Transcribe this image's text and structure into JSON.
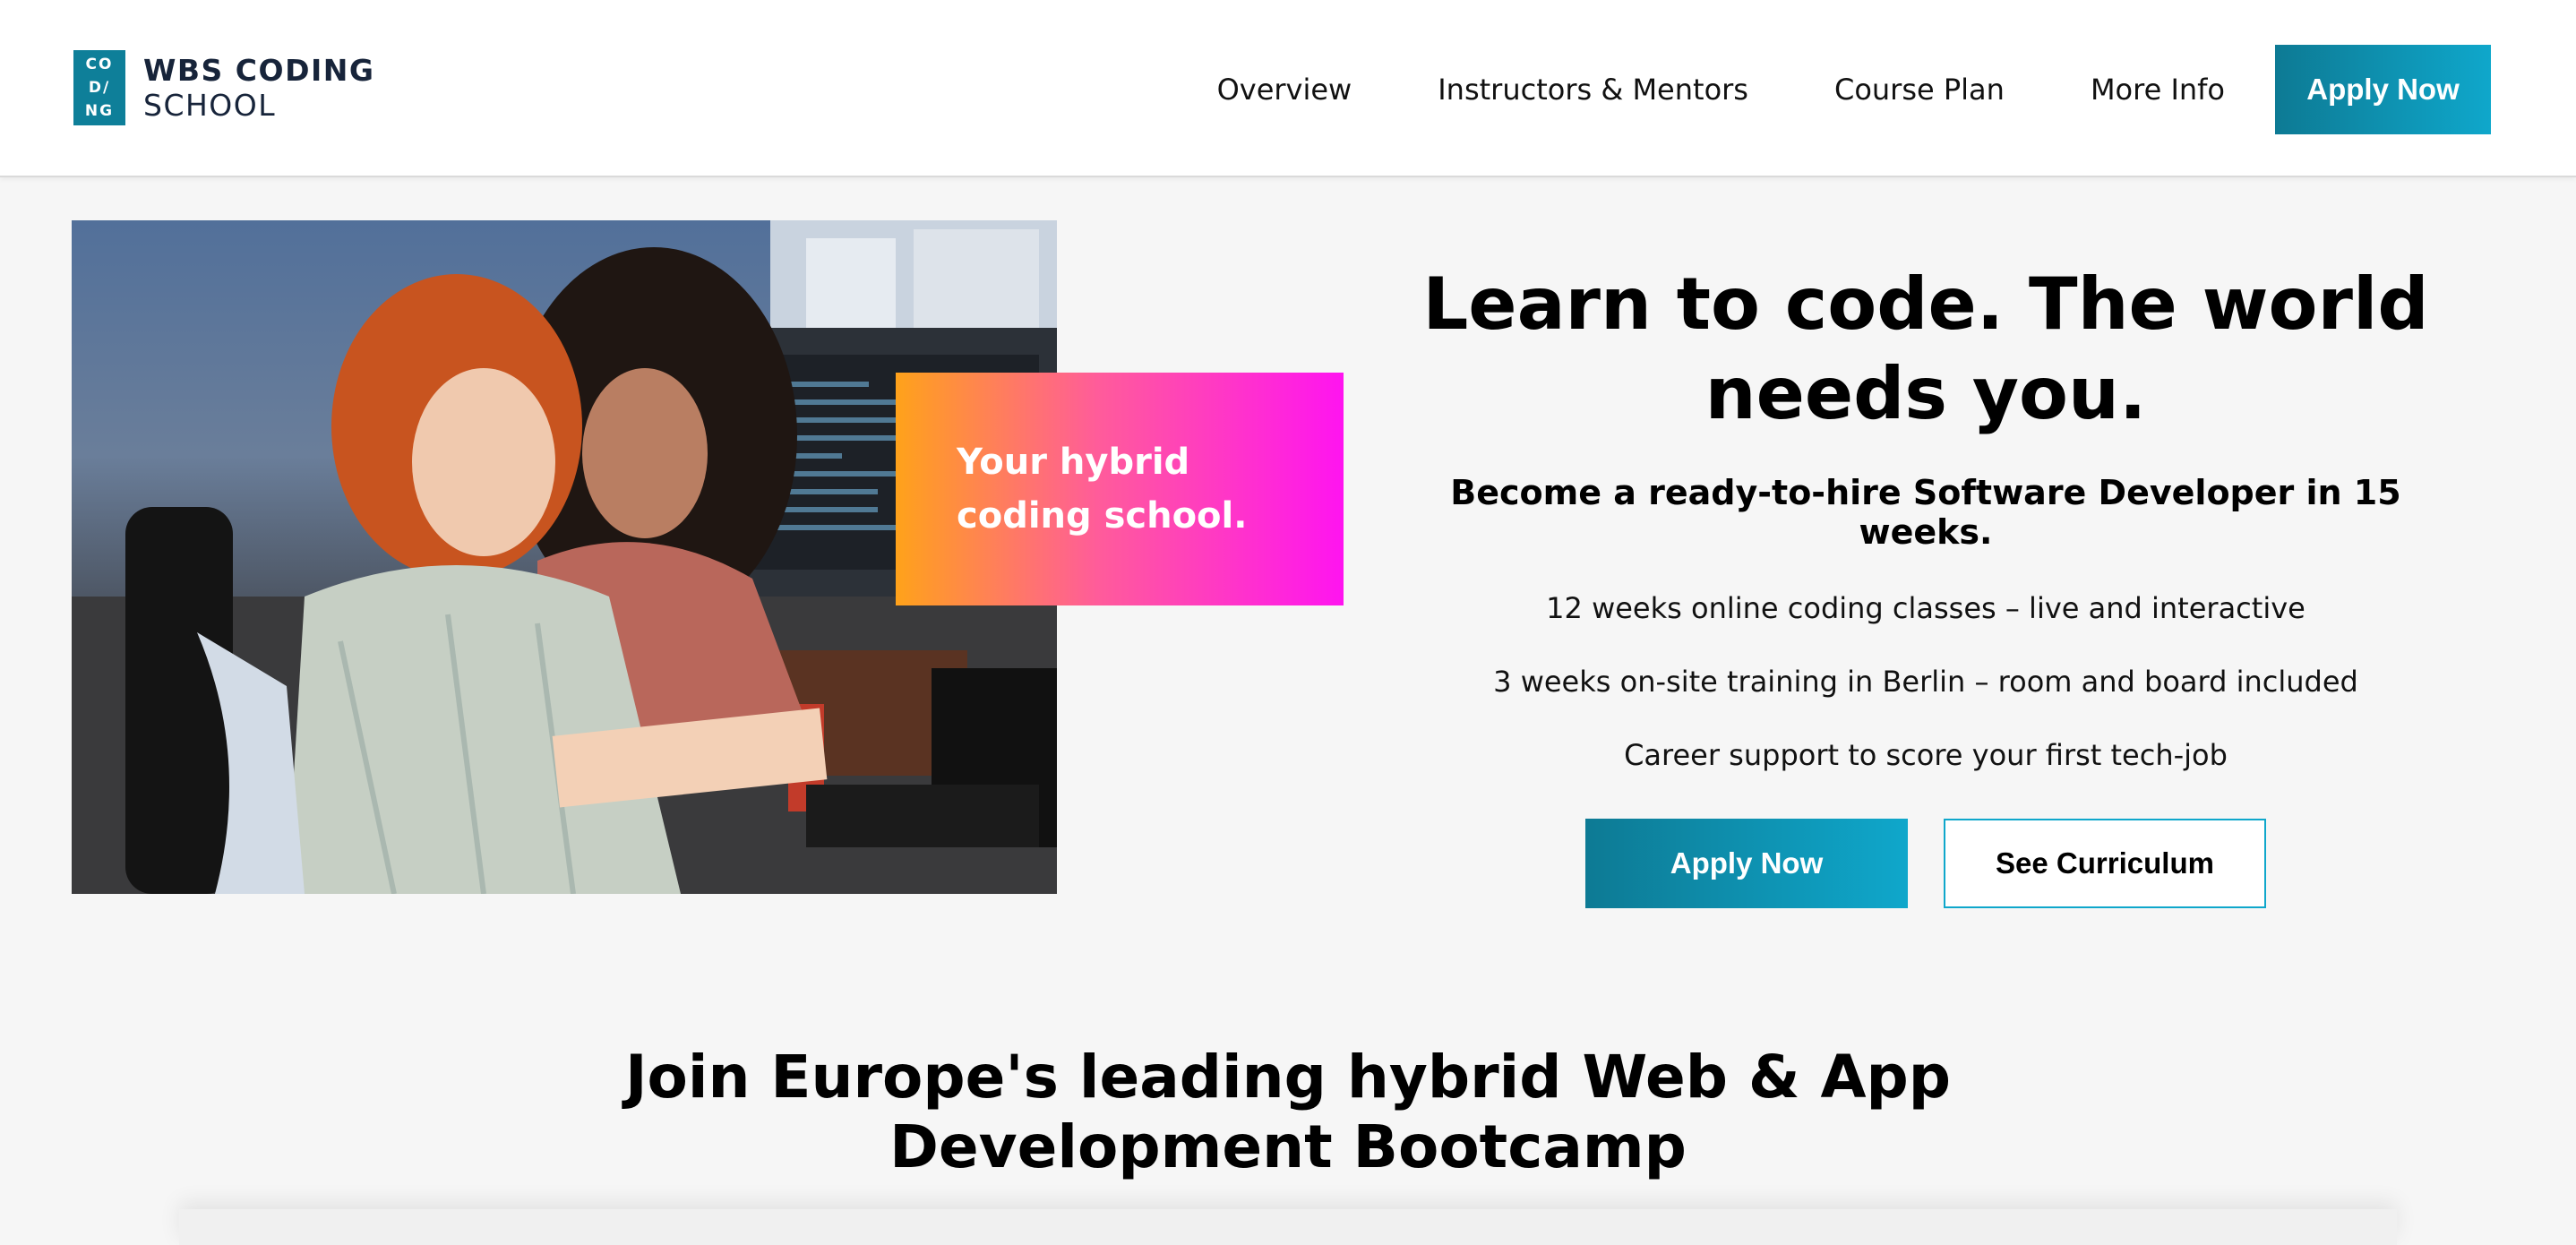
{
  "brand": {
    "logo_mark": [
      "CO",
      "D/",
      "NG"
    ],
    "name_line1": "WBS CODING",
    "name_line2": "SCHOOL",
    "accent_color": "#0e7f99"
  },
  "nav": {
    "items": [
      "Overview",
      "Instructors & Mentors",
      "Course Plan",
      "More Info"
    ],
    "apply_label": "Apply Now"
  },
  "hero": {
    "card_text": "Your hybrid\ncoding school.",
    "title": "Learn to code. The world\nneeds you.",
    "subtitle": "Become a ready-to-hire Software Developer in 15 weeks.",
    "features": [
      "12 weeks online coding classes – live and interactive",
      "3 weeks on-site training in Berlin – room and board included",
      "Career support to score your first tech-job"
    ],
    "apply_label": "Apply Now",
    "curriculum_label": "See Curriculum"
  },
  "section": {
    "title": "Join Europe's leading hybrid Web & App\nDevelopment Bootcamp"
  }
}
